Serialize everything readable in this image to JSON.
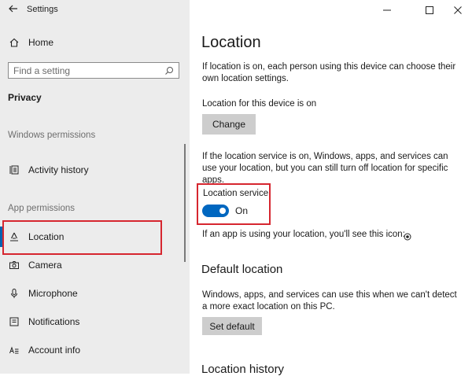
{
  "window": {
    "title": "Settings",
    "controls": {
      "minimize": "—",
      "maximize": "☐",
      "close": "✕"
    }
  },
  "sidebar": {
    "home_label": "Home",
    "search_placeholder": "Find a setting",
    "section_title": "Privacy",
    "categories": {
      "windows_permissions": "Windows permissions",
      "app_permissions": "App permissions"
    },
    "items": [
      {
        "label": "Activity history",
        "icon": "activity-history-icon"
      },
      {
        "label": "Location",
        "icon": "location-icon",
        "selected": true
      },
      {
        "label": "Camera",
        "icon": "camera-icon"
      },
      {
        "label": "Microphone",
        "icon": "microphone-icon"
      },
      {
        "label": "Notifications",
        "icon": "notifications-icon"
      },
      {
        "label": "Account info",
        "icon": "account-info-icon"
      }
    ]
  },
  "main": {
    "title": "Location",
    "intro": "If location is on, each person using this device can choose their own location settings.",
    "device_status": "Location for this device is on",
    "change_button": "Change",
    "service_description": "If the location service is on, Windows, apps, and services can use your location, but you can still turn off location for specific apps.",
    "service_label": "Location service",
    "service_state": "On",
    "service_on": true,
    "icon_note": "If an app is using your location, you'll see this icon:",
    "default_location": {
      "heading": "Default location",
      "description": "Windows, apps, and services can use this when we can't detect a more exact location on this PC.",
      "button": "Set default"
    },
    "history_heading": "Location history"
  },
  "colors": {
    "accent": "#0067c0",
    "highlight_box": "#d6262f",
    "sidebar_bg": "#ececec",
    "button_bg": "#cdcdcd"
  }
}
